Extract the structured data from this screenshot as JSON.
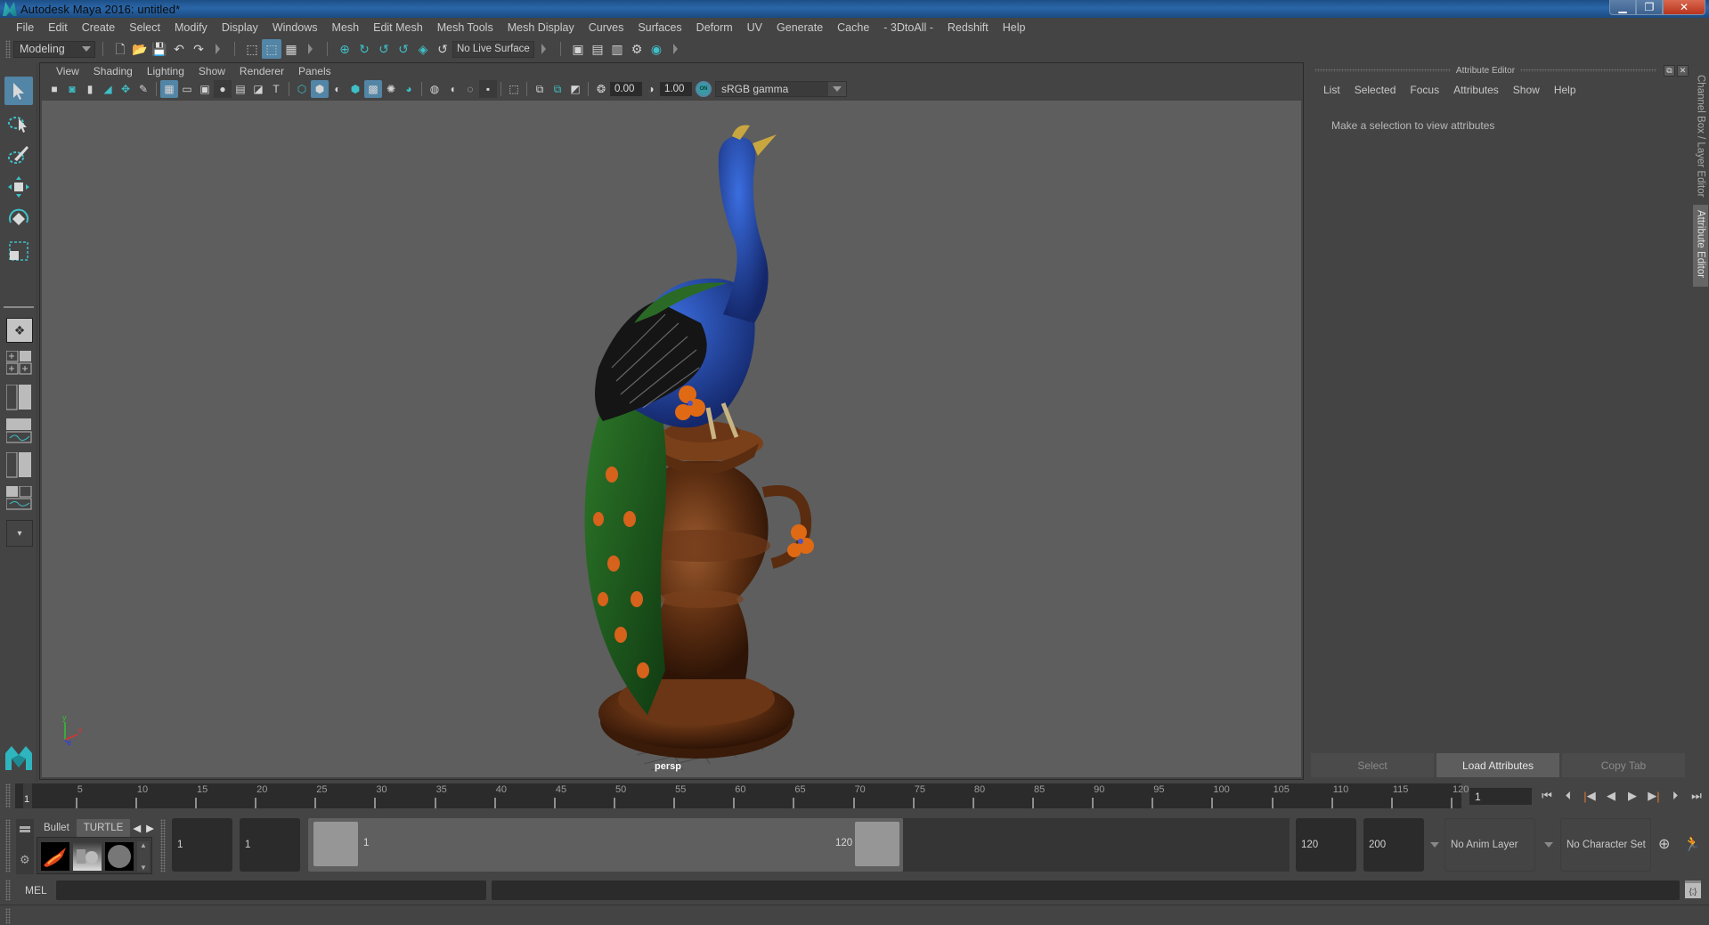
{
  "window": {
    "title": "Autodesk Maya 2016: untitled*",
    "controls": [
      "minimize",
      "restore",
      "close"
    ]
  },
  "menubar": [
    "File",
    "Edit",
    "Create",
    "Select",
    "Modify",
    "Display",
    "Windows",
    "Mesh",
    "Edit Mesh",
    "Mesh Tools",
    "Mesh Display",
    "Curves",
    "Surfaces",
    "Deform",
    "UV",
    "Generate",
    "Cache",
    "- 3DtoAll -",
    "Redshift",
    "Help"
  ],
  "statusline": {
    "menuset": "Modeling",
    "live_surface": "No Live Surface"
  },
  "viewport": {
    "menus": [
      "View",
      "Shading",
      "Lighting",
      "Show",
      "Renderer",
      "Panels"
    ],
    "exposure": "0.00",
    "gamma": "1.00",
    "color_mgmt_toggle": "ON",
    "view_transform": "sRGB gamma",
    "camera_label": "persp",
    "axis_labels": {
      "x": "x",
      "y": "y",
      "z": "z"
    }
  },
  "attribute_editor": {
    "title": "Attribute Editor",
    "menus": [
      "List",
      "Selected",
      "Focus",
      "Attributes",
      "Show",
      "Help"
    ],
    "message": "Make a selection to view attributes",
    "buttons": [
      {
        "label": "Select",
        "active": false
      },
      {
        "label": "Load Attributes",
        "active": true
      },
      {
        "label": "Copy Tab",
        "active": false
      }
    ]
  },
  "side_tabs": [
    {
      "label": "Channel Box / Layer Editor",
      "selected": false
    },
    {
      "label": "Attribute Editor",
      "selected": true
    }
  ],
  "timeline": {
    "ticks": [
      "5",
      "10",
      "15",
      "20",
      "25",
      "30",
      "35",
      "40",
      "45",
      "50",
      "55",
      "60",
      "65",
      "70",
      "75",
      "80",
      "85",
      "90",
      "95",
      "100",
      "105",
      "110",
      "115",
      "120"
    ],
    "current_frame_marker": "1",
    "current_frame": "1",
    "accent": "#e07a3a"
  },
  "shelf": {
    "tabs": [
      "Bullet",
      "TURTLE"
    ],
    "selected_tab": "TURTLE"
  },
  "range": {
    "start": "1",
    "playback_start": "1",
    "range_min_label": "1",
    "range_max_label": "120",
    "playback_end": "120",
    "end": "200",
    "anim_layer": "No Anim Layer",
    "character_set": "No Character Set"
  },
  "command_line": {
    "language": "MEL"
  },
  "colors": {
    "accent_blue": "#5285a6",
    "teal": "#3fbfc7",
    "panel_bg": "#444444",
    "viewport_bg": "#5e5e5e"
  }
}
